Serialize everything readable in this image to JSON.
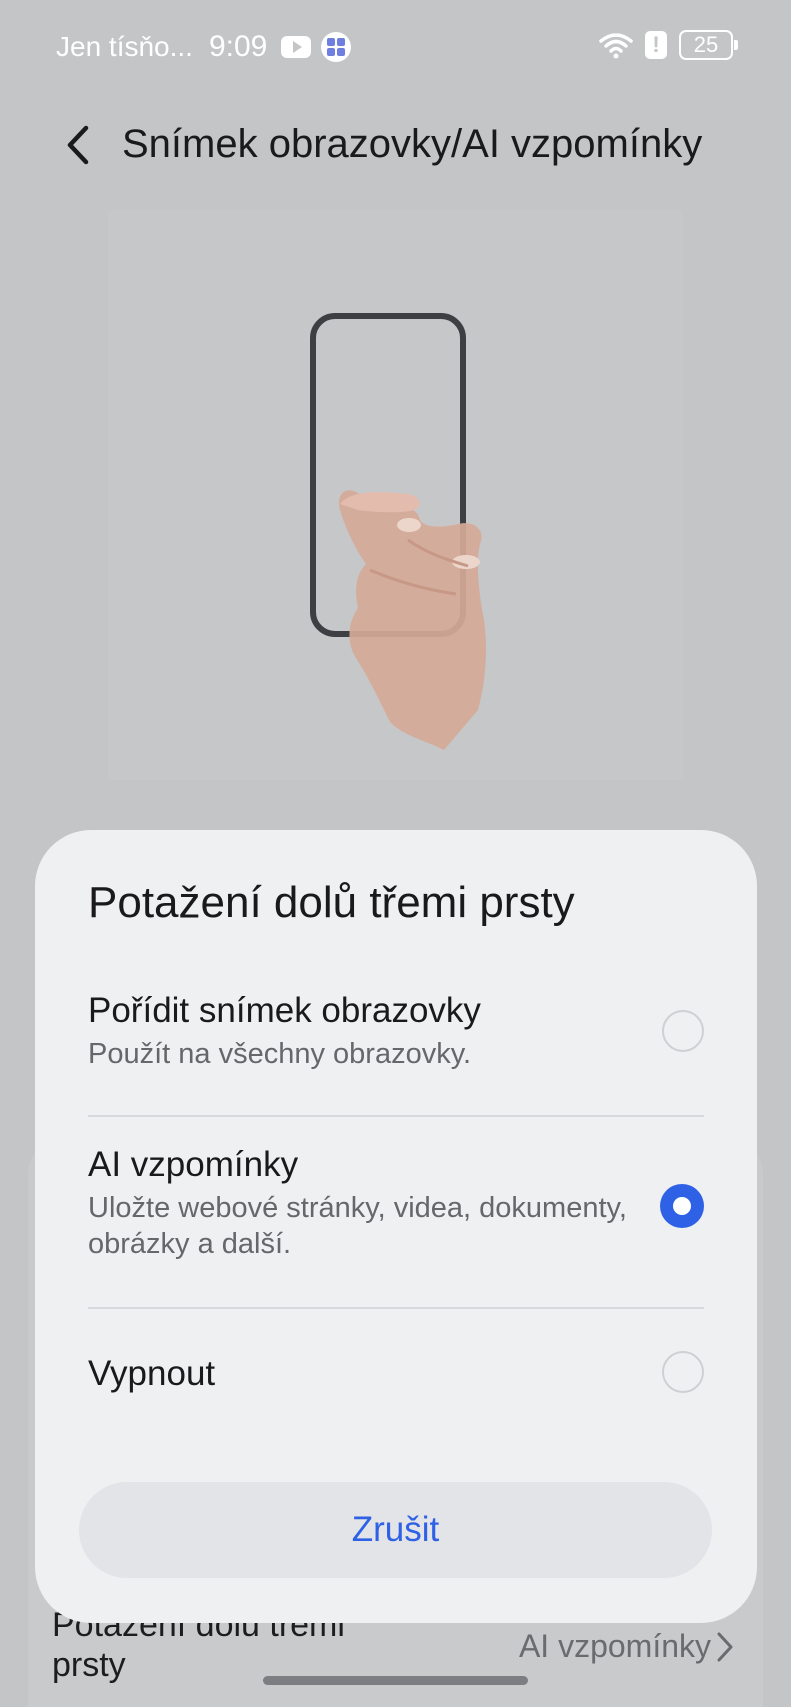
{
  "status_bar": {
    "carrier": "Jen tísňo...",
    "time": "9:09",
    "battery": "25",
    "icons": [
      "youtube-icon",
      "app-grid-icon",
      "wifi-icon",
      "alert-icon",
      "battery-icon"
    ]
  },
  "header": {
    "back_icon": "chevron-left-icon",
    "title": "Snímek obrazovky/AI vzpomínky"
  },
  "illustration": {
    "icon": "phone-three-finger-swipe-illustration"
  },
  "background_row": {
    "label": "Potažení dolů třemi prsty",
    "value": "AI vzpomínky",
    "icon": "chevron-right-icon"
  },
  "dialog": {
    "title": "Potažení dolů třemi prsty",
    "options": [
      {
        "title": "Pořídit snímek obrazovky",
        "description": "Použít na všechny obrazovky.",
        "selected": false
      },
      {
        "title": "AI vzpomínky",
        "description": "Uložte webové stránky, videa, dokumenty, obrázky a další.",
        "selected": true
      },
      {
        "title": "Vypnout",
        "description": "",
        "selected": false
      }
    ],
    "cancel_label": "Zrušit"
  },
  "colors": {
    "accent": "#2f61e6",
    "scrim_background": "#c4c5c7",
    "dialog_background": "#eff0f2"
  }
}
